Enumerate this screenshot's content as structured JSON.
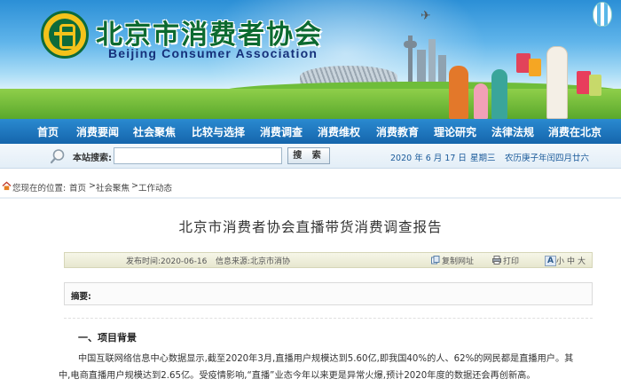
{
  "site": {
    "title_cn": "北京市消费者协会",
    "title_en": "Beijing Consumer Association"
  },
  "nav": {
    "items": [
      "首页",
      "消费要闻",
      "社会聚焦",
      "比较与选择",
      "消费调查",
      "消费维权",
      "消费教育",
      "理论研究",
      "法律法规",
      "消费在北京"
    ]
  },
  "search": {
    "label": "本站搜索:",
    "value": "",
    "button_label": "搜 索"
  },
  "date_bar": {
    "date": "2020 年 6 月 17 日",
    "weekday": "星期三",
    "lunar": "农历庚子年闰四月廿六"
  },
  "breadcrumb": {
    "prefix": "您现在的位置:",
    "items": [
      "首页",
      "社会聚焦",
      "工作动态"
    ],
    "separator": ">"
  },
  "article": {
    "title": "北京市消费者协会直播带货消费调查报告",
    "publish_time": "发布时间:2020-06-16",
    "source": "信息来源:北京市消协",
    "copy_link_label": "复制网址",
    "print_label": "打印",
    "font_size_icon_label": "A",
    "font_sizes": [
      "小",
      "中",
      "大"
    ],
    "summary_label": "摘要:",
    "section_heading": "一、项目背景",
    "paragraph_line1": "中国互联网络信息中心数据显示,截至2020年3月,直播用户规模达到5.60亿,即我国40%的人、62%的网民都是直播用户。其",
    "paragraph_line2": "中,电商直播用户规模达到2.65亿。受疫情影响,“直播”业态今年以来更是异常火爆,预计2020年度的数据还会再创新高。"
  },
  "colors": {
    "nav_bg": "#1a6db5",
    "logo_green": "#0c6a30",
    "logo_sub_blue": "#15307a",
    "meta_bar_bg": "#ececd6"
  }
}
